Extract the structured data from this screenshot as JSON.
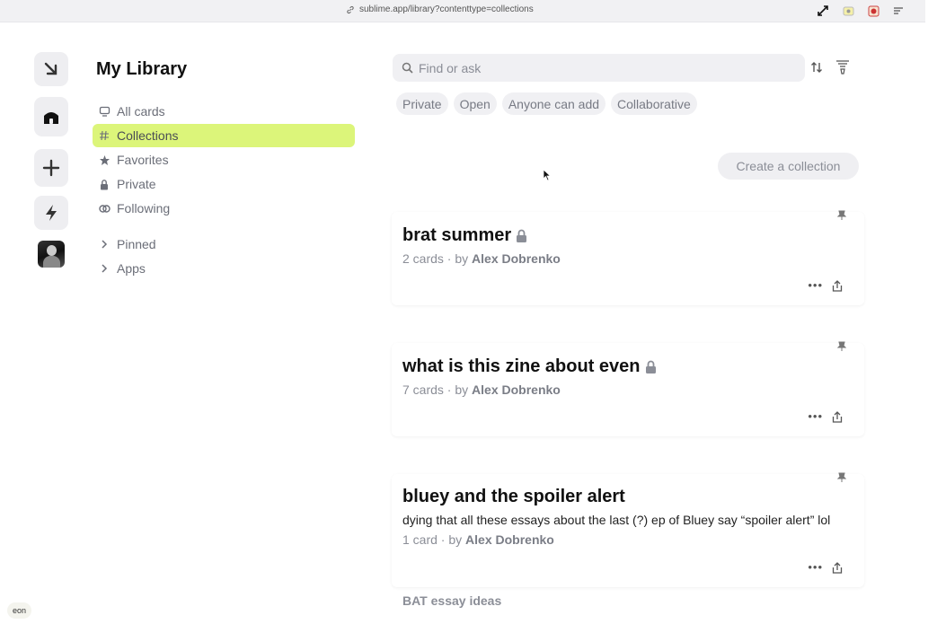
{
  "browser": {
    "url": "sublime.app/library?contenttype=collections"
  },
  "sidebar": {
    "title": "My Library",
    "items": [
      {
        "label": "All cards"
      },
      {
        "label": "Collections"
      },
      {
        "label": "Favorites"
      },
      {
        "label": "Private"
      },
      {
        "label": "Following"
      },
      {
        "label": "Pinned"
      },
      {
        "label": "Apps"
      }
    ]
  },
  "search": {
    "placeholder": "Find or ask"
  },
  "filters": [
    "Private",
    "Open",
    "Anyone can add",
    "Collaborative"
  ],
  "create_button": "Create a collection",
  "collections": [
    {
      "title": "brat summer",
      "meta_prefix": "2 cards · by ",
      "author": "Alex Dobrenko",
      "private": true
    },
    {
      "title": "what is this zine about even",
      "meta_prefix": "7 cards · by ",
      "author": "Alex Dobrenko",
      "private": true
    },
    {
      "title": "bluey and the spoiler alert",
      "description": "dying that all these essays about the last (?) ep of Bluey say “spoiler alert” lol",
      "meta_prefix": "1 card · by ",
      "author": "Alex Dobrenko",
      "private": false
    }
  ],
  "next_collection_title": "BAT essay ideas",
  "bottom_badge": "eon",
  "colors": {
    "active_nav": "#dcf57a",
    "muted_text": "#8b8e97",
    "chip_bg": "#f0f0f3"
  }
}
